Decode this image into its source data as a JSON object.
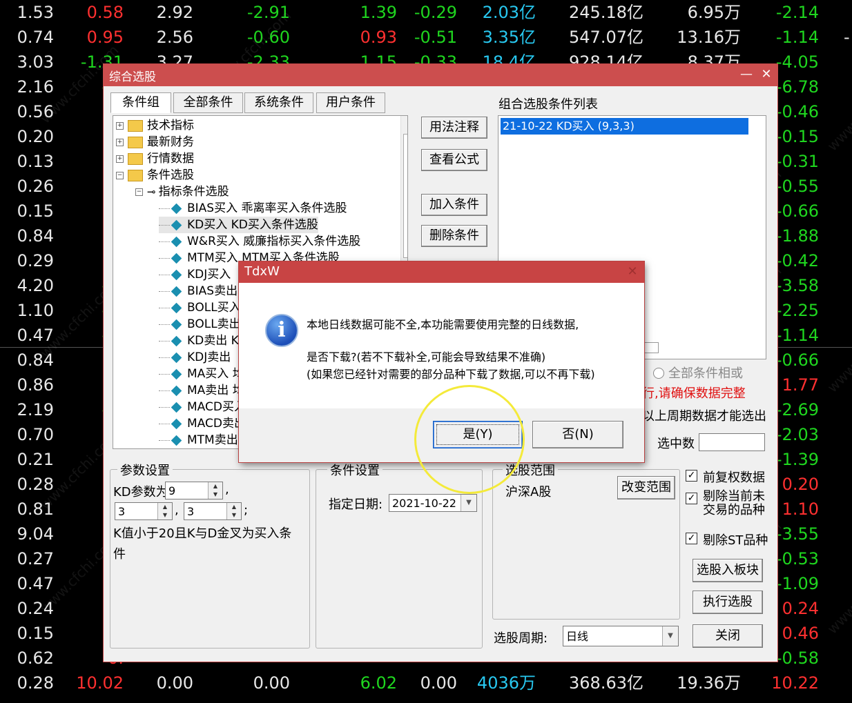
{
  "stock_rows": [
    [
      "1.53",
      "0.58",
      "2.92",
      "-2.91",
      "1.39",
      "-0.29",
      "2.03亿",
      "245.18亿",
      "6.95万",
      "-2.14",
      ""
    ],
    [
      "0.74",
      "0.95",
      "2.56",
      "-0.60",
      "0.93",
      "-0.51",
      "3.35亿",
      "547.07亿",
      "13.16万",
      "-1.14",
      "-"
    ],
    [
      "3.03",
      "-1.31",
      "3.27",
      "-2.33",
      "1.15",
      "-0.33",
      "18.4亿",
      "928.14亿",
      "8.37万",
      "-4.05",
      ""
    ],
    [
      "2.16",
      "-1.",
      "",
      "",
      "",
      "",
      "",
      "",
      "",
      "-6.78",
      ""
    ],
    [
      "0.56",
      "1.",
      "",
      "",
      "",
      "",
      "",
      "",
      "",
      "-0.46",
      ""
    ],
    [
      "0.20",
      "0.",
      "",
      "",
      "",
      "",
      "",
      "",
      "",
      "-0.15",
      ""
    ],
    [
      "0.13",
      "0.",
      "",
      "",
      "",
      "",
      "",
      "",
      "",
      "-0.31",
      ""
    ],
    [
      "0.26",
      "0.",
      "",
      "",
      "",
      "",
      "",
      "",
      "",
      "-0.55",
      ""
    ],
    [
      "0.15",
      "0.",
      "",
      "",
      "",
      "",
      "",
      "",
      "",
      "-0.66",
      ""
    ],
    [
      "0.84",
      "0.",
      "",
      "",
      "",
      "",
      "",
      "",
      "",
      "-1.88",
      ""
    ],
    [
      "0.29",
      "0.",
      "",
      "",
      "",
      "",
      "",
      "",
      "",
      "-0.42",
      ""
    ],
    [
      "4.20",
      "-0.",
      "",
      "",
      "",
      "",
      "",
      "",
      "",
      "-3.58",
      ""
    ],
    [
      "1.10",
      "-0.",
      "",
      "",
      "",
      "",
      "",
      "",
      "",
      "-2.25",
      ""
    ],
    [
      "0.47",
      "-0.",
      "",
      "",
      "",
      "",
      "",
      "",
      "",
      "-1.14",
      ""
    ],
    [
      "0.84",
      "0.",
      "",
      "",
      "",
      "",
      "",
      "",
      "",
      "-0.66",
      ""
    ],
    [
      "0.86",
      "2.",
      "",
      "",
      "",
      "",
      "",
      "",
      "",
      "1.77",
      ""
    ],
    [
      "2.19",
      "-0.",
      "",
      "",
      "",
      "",
      "",
      "",
      "",
      "-2.69",
      ""
    ],
    [
      "0.70",
      "0.",
      "",
      "",
      "",
      "",
      "",
      "",
      "",
      "-2.03",
      ""
    ],
    [
      "0.21",
      "0.",
      "",
      "",
      "",
      "",
      "",
      "",
      "",
      "-1.39",
      ""
    ],
    [
      "0.28",
      "0.",
      "",
      "",
      "",
      "",
      "",
      "",
      "",
      "0.20",
      ""
    ],
    [
      "0.81",
      "1.",
      "",
      "",
      "",
      "",
      "",
      "",
      "",
      "1.10",
      ""
    ],
    [
      "9.04",
      "0.",
      "",
      "",
      "",
      "",
      "",
      "",
      "",
      "-3.55",
      ""
    ],
    [
      "0.27",
      "0.",
      "",
      "",
      "",
      "",
      "",
      "",
      "",
      "-0.53",
      ""
    ],
    [
      "0.47",
      "0.",
      "",
      "",
      "",
      "",
      "",
      "",
      "",
      "-1.09",
      ""
    ],
    [
      "0.24",
      "1.",
      "",
      "",
      "",
      "",
      "",
      "",
      "",
      "0.24",
      ""
    ],
    [
      "0.15",
      "0.",
      "",
      "",
      "",
      "",
      "",
      "",
      "",
      "0.46",
      ""
    ],
    [
      "0.62",
      "0.",
      "",
      "",
      "",
      "",
      "",
      "",
      "",
      "-0.58",
      ""
    ],
    [
      "0.28",
      "10.02",
      "0.00",
      "0.00",
      "6.02",
      "0.00",
      "4036万",
      "368.63亿",
      "19.36万",
      "10.22",
      ""
    ]
  ],
  "stock_colors": [
    [
      "wht",
      "red",
      "wht",
      "grn",
      "grn",
      "grn",
      "cyn",
      "wht",
      "wht",
      "grn",
      "wht"
    ],
    [
      "wht",
      "red",
      "wht",
      "grn",
      "red",
      "grn",
      "cyn",
      "wht",
      "wht",
      "grn",
      "wht"
    ],
    [
      "wht",
      "grn",
      "wht",
      "grn",
      "grn",
      "grn",
      "cyn",
      "wht",
      "wht",
      "grn",
      "wht"
    ],
    [
      "wht",
      "grn",
      "",
      "",
      "",
      "",
      "",
      "",
      "",
      "grn",
      ""
    ],
    [
      "wht",
      "red",
      "",
      "",
      "",
      "",
      "",
      "",
      "",
      "grn",
      ""
    ],
    [
      "wht",
      "red",
      "",
      "",
      "",
      "",
      "",
      "",
      "",
      "grn",
      ""
    ],
    [
      "wht",
      "red",
      "",
      "",
      "",
      "",
      "",
      "",
      "",
      "grn",
      ""
    ],
    [
      "wht",
      "wht",
      "",
      "",
      "",
      "",
      "",
      "",
      "",
      "grn",
      ""
    ],
    [
      "wht",
      "red",
      "",
      "",
      "",
      "",
      "",
      "",
      "",
      "grn",
      ""
    ],
    [
      "wht",
      "red",
      "",
      "",
      "",
      "",
      "",
      "",
      "",
      "grn",
      ""
    ],
    [
      "wht",
      "red",
      "",
      "",
      "",
      "",
      "",
      "",
      "",
      "grn",
      ""
    ],
    [
      "wht",
      "grn",
      "",
      "",
      "",
      "",
      "",
      "",
      "",
      "grn",
      ""
    ],
    [
      "wht",
      "grn",
      "",
      "",
      "",
      "",
      "",
      "",
      "",
      "grn",
      ""
    ],
    [
      "wht",
      "grn",
      "",
      "",
      "",
      "",
      "",
      "",
      "",
      "grn",
      ""
    ],
    [
      "wht",
      "red",
      "",
      "",
      "",
      "",
      "",
      "",
      "",
      "grn",
      ""
    ],
    [
      "wht",
      "red",
      "",
      "",
      "",
      "",
      "",
      "",
      "",
      "red",
      ""
    ],
    [
      "wht",
      "grn",
      "",
      "",
      "",
      "",
      "",
      "",
      "",
      "grn",
      ""
    ],
    [
      "wht",
      "wht",
      "",
      "",
      "",
      "",
      "",
      "",
      "",
      "grn",
      ""
    ],
    [
      "wht",
      "red",
      "",
      "",
      "",
      "",
      "",
      "",
      "",
      "grn",
      ""
    ],
    [
      "wht",
      "red",
      "",
      "",
      "",
      "",
      "",
      "",
      "",
      "red",
      ""
    ],
    [
      "wht",
      "red",
      "",
      "",
      "",
      "",
      "",
      "",
      "",
      "red",
      ""
    ],
    [
      "wht",
      "red",
      "",
      "",
      "",
      "",
      "",
      "",
      "",
      "grn",
      ""
    ],
    [
      "wht",
      "red",
      "",
      "",
      "",
      "",
      "",
      "",
      "",
      "grn",
      ""
    ],
    [
      "wht",
      "red",
      "",
      "",
      "",
      "",
      "",
      "",
      "",
      "grn",
      ""
    ],
    [
      "wht",
      "red",
      "",
      "",
      "",
      "",
      "",
      "",
      "",
      "red",
      ""
    ],
    [
      "wht",
      "red",
      "",
      "",
      "",
      "",
      "",
      "",
      "",
      "red",
      ""
    ],
    [
      "wht",
      "red",
      "",
      "",
      "",
      "",
      "",
      "",
      "",
      "grn",
      ""
    ],
    [
      "wht",
      "red",
      "wht",
      "wht",
      "grn",
      "wht",
      "cyn",
      "wht",
      "wht",
      "red",
      ""
    ]
  ],
  "dialog": {
    "title": "综合选股",
    "minimize": "—",
    "close": "✕",
    "tabs": [
      "条件组",
      "全部条件",
      "系统条件",
      "用户条件"
    ],
    "tree": {
      "nodes": [
        "技术指标",
        "最新财务",
        "行情数据",
        "条件选股"
      ],
      "sub_node": "指标条件选股",
      "leaves": [
        "BIAS买入  乖离率买入条件选股",
        "KD买入  KD买入条件选股",
        "W&R买入  威廉指标买入条件选股",
        "MTM买入  MTM买入条件选股",
        "KDJ买入",
        "BIAS卖出",
        "BOLL买入",
        "BOLL卖出",
        "KD卖出  K",
        "KDJ卖出",
        "MA买入  均",
        "MA卖出  均",
        "MACD买入",
        "MACD卖出",
        "MTM卖出"
      ]
    },
    "buttons": {
      "usage_note": "用法注释",
      "view_formula": "查看公式",
      "add_condition": "加入条件",
      "delete_condition": "删除条件"
    },
    "list_title": "组合选股条件列表",
    "list_items": [
      "21-10-22  KD买入 (9,3,3)"
    ],
    "radio_all_or": "全部条件相或",
    "warning_text": "行,请确保数据完整",
    "period_note": "以上周期数据才能选出",
    "selected_count_label": "选中数",
    "param_group": {
      "title": "参数设置",
      "kd_label": "KD参数为",
      "kd1": "9",
      "kd2": "3",
      "kd3": "3",
      "comma": ",",
      "semicolon": ";",
      "desc": "K值小于20且K与D金叉为买入条件"
    },
    "cond_group": {
      "title": "条件设置",
      "date_label": "指定日期:",
      "date_value": "2021-10-22"
    },
    "range_group": {
      "title": "选股范围",
      "range_value": "沪深A股",
      "change_range": "改变范围"
    },
    "checkboxes": {
      "forward_adjust": "前复权数据",
      "exclude_untraded": "剔除当前未交易的品种",
      "exclude_st": "剔除ST品种"
    },
    "period_label": "选股周期:",
    "period_value": "日线",
    "select_to_block": "选股入板块",
    "run_select": "执行选股",
    "close_button": "关闭"
  },
  "msgbox": {
    "title": "TdxW",
    "close": "✕",
    "icon": "info-icon",
    "line1": "本地日线数据可能不全,本功能需要使用完整的日线数据,",
    "line2": "是否下载?(若不下载补全,可能会导致结果不准确)",
    "line3": "(如果您已经针对需要的部分品种下载了数据,可以不再下载)",
    "yes": "是(Y)",
    "no": "否(N)"
  },
  "watermark": "www.cfchi.com",
  "colors": {
    "title_bar": "#cc4e4e",
    "list_selection": "#0e6ee0",
    "highlight_ring": "#f4ea3a"
  }
}
